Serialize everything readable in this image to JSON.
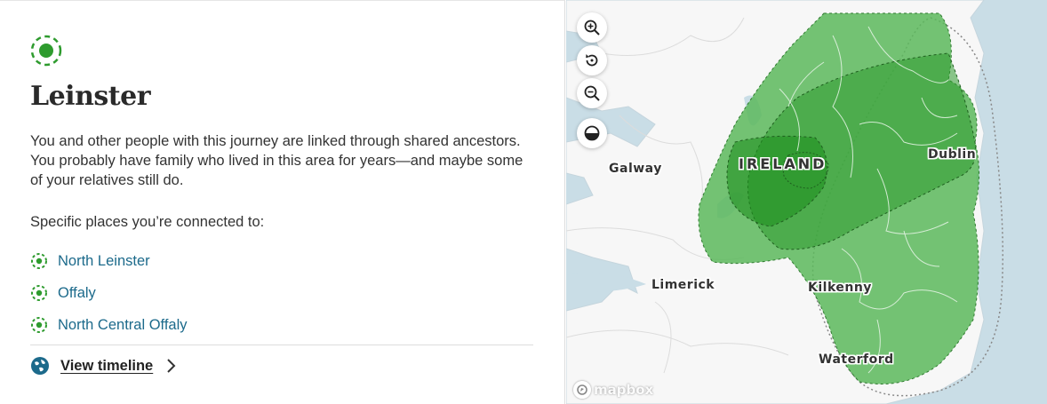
{
  "panel": {
    "title": "Leinster",
    "description": "You and other people with this journey are linked through shared ancestors. You probably have family who lived in this area for years—and maybe some of your relatives still do.",
    "places_heading": "Specific places you’re connected to:",
    "places": [
      {
        "label": "North Leinster",
        "icon": "dashed-circle-icon"
      },
      {
        "label": "Offaly",
        "icon": "dashed-circle-icon"
      },
      {
        "label": "North Central Offaly",
        "icon": "dashed-circle-icon"
      }
    ],
    "timeline_link": "View timeline",
    "accent_color": "#2e9b2e",
    "link_color": "#1c6a8b"
  },
  "map": {
    "labels": {
      "ireland": "IRELAND",
      "galway": "Galway",
      "dublin": "Dublin",
      "limerick": "Limerick",
      "kilkenny": "Kilkenny",
      "waterford": "Waterford"
    },
    "controls": [
      "zoom-in-icon",
      "reset-icon",
      "zoom-out-icon",
      "contrast-icon"
    ],
    "attribution": "mapbox",
    "region_fill": "#5cb85c",
    "region_fill_dark": "#3da63d",
    "land_color": "#f7f7f7",
    "water_color": "#c9dde6"
  }
}
